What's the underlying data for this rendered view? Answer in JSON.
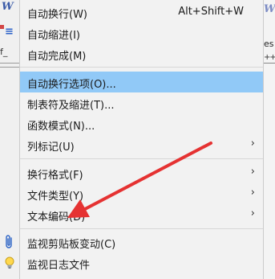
{
  "left_gutter": {
    "w_glyph": "W",
    "f_glyph": "f_"
  },
  "right_gutter": {
    "w_glyph": "W",
    "es_text": "es",
    "plus_text": "++"
  },
  "menu": {
    "items": [
      {
        "label": "自动换行(W)",
        "shortcut": "Alt+Shift+W"
      },
      {
        "label": "自动缩进(I)"
      },
      {
        "label": "自动完成(M)"
      },
      {
        "label": "自动换行选项(O)...",
        "highlighted": true
      },
      {
        "label": "制表符及缩进(T)..."
      },
      {
        "label": "函数模式(N)..."
      },
      {
        "label": "列标记(U)",
        "submenu": true
      },
      {
        "label": "换行格式(F)",
        "submenu": true
      },
      {
        "label": "文件类型(Y)",
        "submenu": true
      },
      {
        "label": "文本编码(D)",
        "submenu": true
      },
      {
        "label": "监视剪贴板变动(C)",
        "icon": "paperclip-icon"
      },
      {
        "label": "监视日志文件",
        "icon": "lightbulb-icon"
      }
    ],
    "submenu_arrow": "›"
  },
  "colors": {
    "highlight": "#91c9f7",
    "menu_bg": "#f2f2f2",
    "annotation_arrow": "#e53232"
  }
}
